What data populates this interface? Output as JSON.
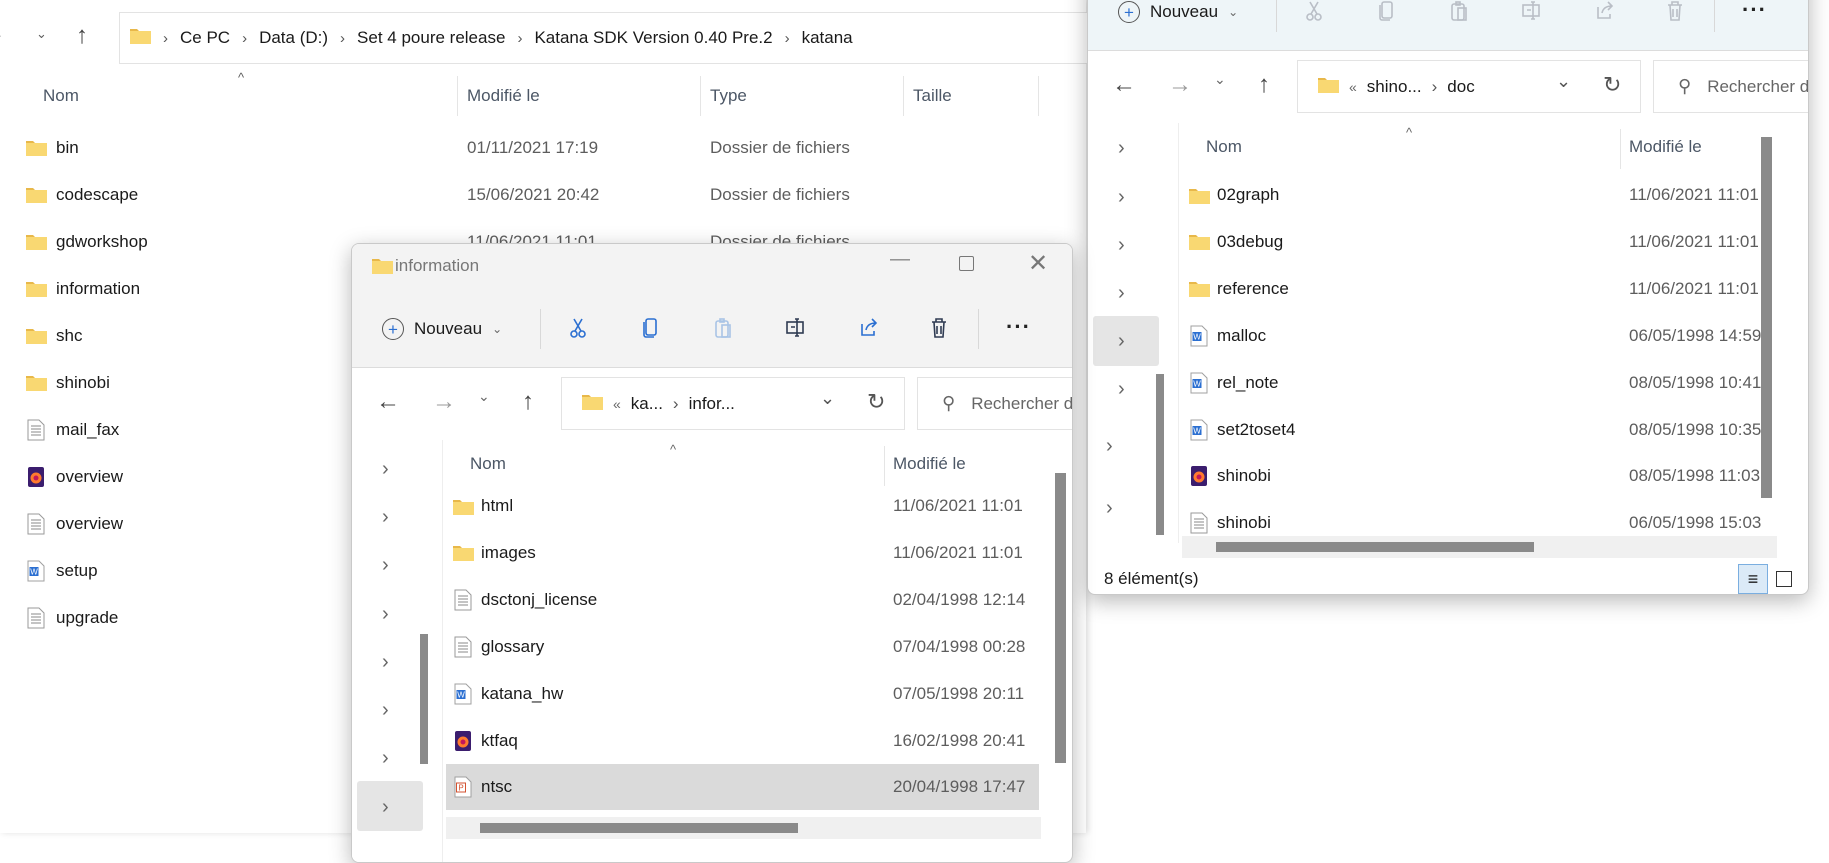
{
  "main": {
    "breadcrumb": [
      "Ce PC",
      "Data (D:)",
      "Set 4 poure release",
      "Katana SDK Version 0.40 Pre.2",
      "katana"
    ],
    "columns": {
      "name": "Nom",
      "modified": "Modifié le",
      "type": "Type",
      "size": "Taille"
    },
    "items": [
      {
        "name": "bin",
        "icon": "folder",
        "modified": "01/11/2021 17:19",
        "type": "Dossier de fichiers"
      },
      {
        "name": "codescape",
        "icon": "folder",
        "modified": "15/06/2021 20:42",
        "type": "Dossier de fichiers"
      },
      {
        "name": "gdworkshop",
        "icon": "folder",
        "modified": "11/06/2021 11:01",
        "type": "Dossier de fichiers"
      },
      {
        "name": "information",
        "icon": "folder"
      },
      {
        "name": "shc",
        "icon": "folder"
      },
      {
        "name": "shinobi",
        "icon": "folder"
      },
      {
        "name": "mail_fax",
        "icon": "text"
      },
      {
        "name": "overview",
        "icon": "firefox"
      },
      {
        "name": "overview",
        "icon": "text"
      },
      {
        "name": "setup",
        "icon": "word"
      },
      {
        "name": "upgrade",
        "icon": "text"
      }
    ]
  },
  "info_window": {
    "title": "information",
    "new_label": "Nouveau",
    "path": [
      "ka...",
      "infor..."
    ],
    "search_placeholder": "Rechercher d",
    "columns": {
      "name": "Nom",
      "modified": "Modifié le"
    },
    "items": [
      {
        "name": "html",
        "icon": "folder",
        "modified": "11/06/2021 11:01"
      },
      {
        "name": "images",
        "icon": "folder",
        "modified": "11/06/2021 11:01"
      },
      {
        "name": "dsctonj_license",
        "icon": "text",
        "modified": "02/04/1998 12:14"
      },
      {
        "name": "glossary",
        "icon": "text",
        "modified": "07/04/1998 00:28"
      },
      {
        "name": "katana_hw",
        "icon": "word",
        "modified": "07/05/1998 20:11"
      },
      {
        "name": "ktfaq",
        "icon": "firefox",
        "modified": "16/02/1998 20:41"
      },
      {
        "name": "ntsc",
        "icon": "ppt",
        "modified": "20/04/1998 17:47",
        "selected": true
      }
    ]
  },
  "doc_window": {
    "new_label": "Nouveau",
    "path": [
      "shino...",
      "doc"
    ],
    "search_placeholder": "Rechercher d",
    "columns": {
      "name": "Nom",
      "modified": "Modifié le"
    },
    "status": "8 élément(s)",
    "items": [
      {
        "name": "02graph",
        "icon": "folder",
        "modified": "11/06/2021 11:01"
      },
      {
        "name": "03debug",
        "icon": "folder",
        "modified": "11/06/2021 11:01"
      },
      {
        "name": "reference",
        "icon": "folder",
        "modified": "11/06/2021 11:01"
      },
      {
        "name": "malloc",
        "icon": "word",
        "modified": "06/05/1998 14:59"
      },
      {
        "name": "rel_note",
        "icon": "word",
        "modified": "08/05/1998 10:41"
      },
      {
        "name": "set2toset4",
        "icon": "word",
        "modified": "08/05/1998 10:35"
      },
      {
        "name": "shinobi",
        "icon": "firefox",
        "modified": "08/05/1998 11:03"
      },
      {
        "name": "shinobi",
        "icon": "text",
        "modified": "06/05/1998 15:03"
      }
    ]
  },
  "colors": {
    "accent": "#0067c0",
    "folder": "#f8d775",
    "selected": "#dadada"
  }
}
